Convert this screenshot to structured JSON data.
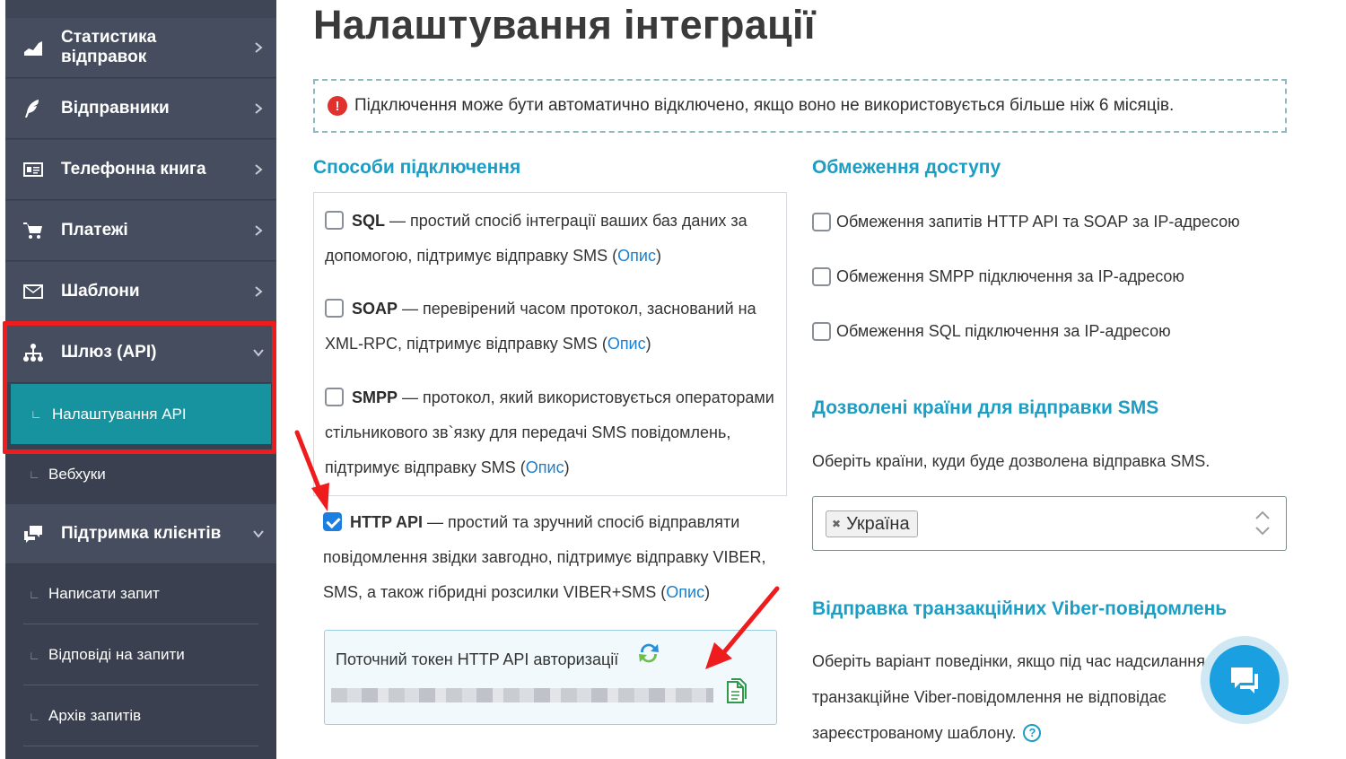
{
  "sidebar": {
    "items": [
      {
        "label": "Статистика відправок",
        "icon": "chart-icon"
      },
      {
        "label": "Відправники",
        "icon": "feather-icon"
      },
      {
        "label": "Телефонна книга",
        "icon": "contacts-icon"
      },
      {
        "label": "Платежі",
        "icon": "cart-icon"
      },
      {
        "label": "Шаблони",
        "icon": "envelope-icon"
      },
      {
        "label": "Шлюз (API)",
        "icon": "network-icon",
        "expanded": true
      },
      {
        "label": "Підтримка клієнтів",
        "icon": "chat-bubbles-icon",
        "expanded": true
      }
    ],
    "gateway_sub": [
      {
        "label": "Налаштування API",
        "active": true
      },
      {
        "label": "Вебхуки"
      }
    ],
    "support_sub": [
      {
        "label": "Написати запит"
      },
      {
        "label": "Відповіді на запити"
      },
      {
        "label": "Архів запитів"
      }
    ]
  },
  "main": {
    "title": "Налаштування інтеграції",
    "warning": "Підключення може бути автоматично відключено, якщо воно не використовується більше ніж 6 місяців.",
    "methods_heading": "Способи підключення",
    "description_link": "Опис",
    "methods": [
      {
        "name": "SQL",
        "line1": " — простий спосіб інтеграції ваших баз даних за",
        "line2": "допомогою, підтримує відправку SMS (",
        "checked": false
      },
      {
        "name": "SOAP",
        "line1": " — перевірений часом протокол, заснований на",
        "line2": "XML-RPC, підтримує відправку SMS (",
        "checked": false
      },
      {
        "name": "SMPP",
        "line1": " — протокол, який використовується операторами",
        "line2": "стільникового зв`язку для передачі SMS повідомлень,",
        "line3": "підтримує відправку SMS (",
        "checked": false
      }
    ],
    "http_api": {
      "name": "HTTP API",
      "line1": " — простий та зручний спосіб відправляти",
      "line2": "повідомлення звідки завгодно, підтримує відправку VIBER,",
      "line3": "SMS, а також гібридні розсилки VIBER+SMS (",
      "checked": true
    },
    "token_label": "Поточний токен HTTP API авторизації",
    "access_heading": "Обмеження доступу",
    "access_options": [
      "Обмеження запитів HTTP API та SOAP за IP-адресою",
      "Обмеження SMPP підключення за IP-адресою",
      "Обмеження SQL підключення за IP-адресою"
    ],
    "countries_heading": "Дозволені країни для відправки SMS",
    "countries_text": "Оберіть країни, куди буде дозволена відправка SMS.",
    "selected_country": "Україна",
    "viber_heading": "Відправка транзакційних Viber-повідомлень",
    "viber_text1": "Оберіть варіант поведінки, якщо під час надсилання",
    "viber_text2": "транзакційне Viber-повідомлення не відповідає",
    "viber_text3": "зареєстрованому шаблону.",
    "help_glyph": "?"
  },
  "colors": {
    "sidebar_bg": "#464d5e",
    "active_item": "#16939e",
    "heading": "#1b9dc4",
    "highlight": "#ee1c1c",
    "checkbox_checked": "#1c7fe0"
  }
}
